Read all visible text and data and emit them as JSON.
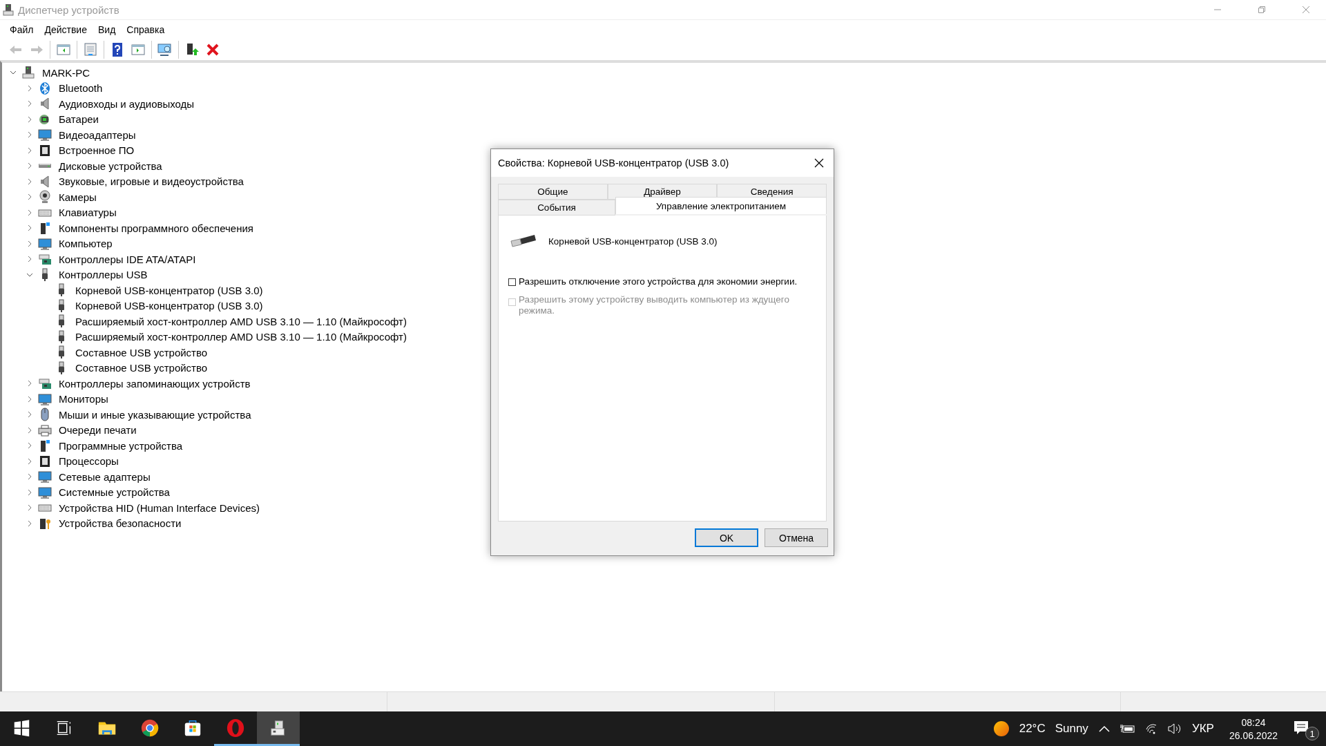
{
  "window": {
    "title": "Диспетчер устройств"
  },
  "menu": [
    "Файл",
    "Действие",
    "Вид",
    "Справка"
  ],
  "toolbar": [
    [
      {
        "kind": "back",
        "disabled": true
      },
      {
        "kind": "forward",
        "disabled": true
      }
    ],
    [
      {
        "kind": "console-tree",
        "disabled": false
      }
    ],
    [
      {
        "kind": "properties",
        "disabled": false
      }
    ],
    [
      {
        "kind": "help",
        "disabled": false
      },
      {
        "kind": "action-pane",
        "disabled": false
      }
    ],
    [
      {
        "kind": "scan",
        "disabled": false
      }
    ],
    [
      {
        "kind": "update",
        "disabled": false
      },
      {
        "kind": "uninstall",
        "disabled": false
      }
    ]
  ],
  "tree": {
    "label": "MARK-PC",
    "kind": "computer",
    "expanded": true,
    "children": [
      {
        "label": "Bluetooth",
        "kind": "bluetooth",
        "expanded": false
      },
      {
        "label": "Аудиовходы и аудиовыходы",
        "kind": "speaker",
        "expanded": false
      },
      {
        "label": "Батареи",
        "kind": "battery",
        "expanded": false
      },
      {
        "label": "Видеоадаптеры",
        "kind": "monitor",
        "expanded": false
      },
      {
        "label": "Встроенное ПО",
        "kind": "chip",
        "expanded": false
      },
      {
        "label": "Дисковые устройства",
        "kind": "disk",
        "expanded": false
      },
      {
        "label": "Звуковые, игровые и видеоустройства",
        "kind": "speaker",
        "expanded": false
      },
      {
        "label": "Камеры",
        "kind": "camera",
        "expanded": false
      },
      {
        "label": "Клавиатуры",
        "kind": "keyboard",
        "expanded": false
      },
      {
        "label": "Компоненты программного обеспечения",
        "kind": "software",
        "expanded": false
      },
      {
        "label": "Компьютер",
        "kind": "monitor",
        "expanded": false
      },
      {
        "label": "Контроллеры IDE ATA/ATAPI",
        "kind": "board",
        "expanded": false
      },
      {
        "label": "Контроллеры USB",
        "kind": "usb",
        "expanded": true,
        "children": [
          {
            "label": "Корневой USB-концентратор (USB 3.0)",
            "kind": "usb"
          },
          {
            "label": "Корневой USB-концентратор (USB 3.0)",
            "kind": "usb"
          },
          {
            "label": "Расширяемый хост-контроллер AMD USB 3.10 — 1.10 (Майкрософт)",
            "kind": "usb"
          },
          {
            "label": "Расширяемый хост-контроллер AMD USB 3.10 — 1.10 (Майкрософт)",
            "kind": "usb"
          },
          {
            "label": "Составное USB устройство",
            "kind": "usb"
          },
          {
            "label": "Составное USB устройство",
            "kind": "usb"
          }
        ]
      },
      {
        "label": "Контроллеры запоминающих устройств",
        "kind": "board",
        "expanded": false
      },
      {
        "label": "Мониторы",
        "kind": "monitor",
        "expanded": false
      },
      {
        "label": "Мыши и иные указывающие устройства",
        "kind": "mouse",
        "expanded": false
      },
      {
        "label": "Очереди печати",
        "kind": "printer",
        "expanded": false
      },
      {
        "label": "Программные устройства",
        "kind": "software",
        "expanded": false
      },
      {
        "label": "Процессоры",
        "kind": "chip",
        "expanded": false
      },
      {
        "label": "Сетевые адаптеры",
        "kind": "monitor",
        "expanded": false
      },
      {
        "label": "Системные устройства",
        "kind": "monitor",
        "expanded": false
      },
      {
        "label": "Устройства HID (Human Interface Devices)",
        "kind": "keyboard",
        "expanded": false
      },
      {
        "label": "Устройства безопасности",
        "kind": "key",
        "expanded": false
      }
    ]
  },
  "dialog": {
    "title": "Свойства: Корневой USB-концентратор (USB 3.0)",
    "tab_rows": [
      [
        {
          "label": "Общие",
          "selected": false
        },
        {
          "label": "Драйвер",
          "selected": false
        },
        {
          "label": "Сведения",
          "selected": false
        }
      ],
      [
        {
          "label": "События",
          "selected": false
        },
        {
          "label": "Управление электропитанием",
          "selected": true
        }
      ]
    ],
    "device_name": "Корневой USB-концентратор (USB 3.0)",
    "options": [
      {
        "label": "Разрешить отключение этого устройства для экономии энергии.",
        "checked": false,
        "disabled": false
      },
      {
        "label": "Разрешить этому устройству выводить компьютер из ждущего режима.",
        "checked": false,
        "disabled": true
      }
    ],
    "buttons": [
      {
        "label": "OK",
        "default": true
      },
      {
        "label": "Отмена",
        "default": false
      }
    ]
  },
  "taskbar": {
    "apps": [
      {
        "kind": "start",
        "running": false,
        "active": false
      },
      {
        "kind": "task-view",
        "running": false,
        "active": false
      },
      {
        "kind": "folder",
        "running": false,
        "active": false
      },
      {
        "kind": "browser",
        "running": false,
        "active": false
      },
      {
        "kind": "store",
        "running": false,
        "active": false
      },
      {
        "kind": "opera",
        "running": true,
        "active": false
      },
      {
        "kind": "device-manager",
        "running": true,
        "active": true
      }
    ],
    "weather": {
      "temperature": "22°C",
      "condition": "Sunny"
    },
    "language": "УКР",
    "time": "08:24",
    "date": "26.06.2022",
    "notifications": "1"
  }
}
